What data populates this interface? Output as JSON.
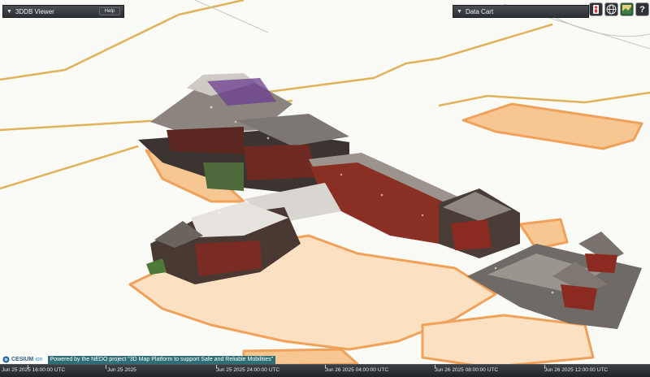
{
  "viewer_panel": {
    "title": "3DDB Viewer",
    "help_label": "Help"
  },
  "datacart_panel": {
    "title": "Data Cart"
  },
  "toolbar": {
    "icons": [
      "person-icon",
      "globe-icon",
      "map-layers-icon",
      "help-icon"
    ],
    "help_glyph": "?"
  },
  "credits": {
    "logo_text": "CESIUM",
    "logo_suffix": "ion",
    "powered_text": "Powered by the NEDO project \"3D Map Platform to support Safe and Reliable Mobilities\""
  },
  "timeline": {
    "labels": [
      "Jun 25 2025 16:00:00 UTC",
      "Jun 25 2025",
      "Jun 25 2025 24:00:00 UTC",
      "Jun 26 2025 04:00:00 UTC",
      "Jun 26 2025 08:00:00 UTC",
      "Jun 26 2025 12:00:00 UTC"
    ]
  },
  "colors": {
    "map_bg": "#fafaf7",
    "road_line": "#e2b25a",
    "block_fill": "#f7c793",
    "block_edge": "#f0a15a",
    "roof_gray": "#6f6a66",
    "wood_red": "#8a2a20",
    "teal_banner": "#2e6e76"
  }
}
